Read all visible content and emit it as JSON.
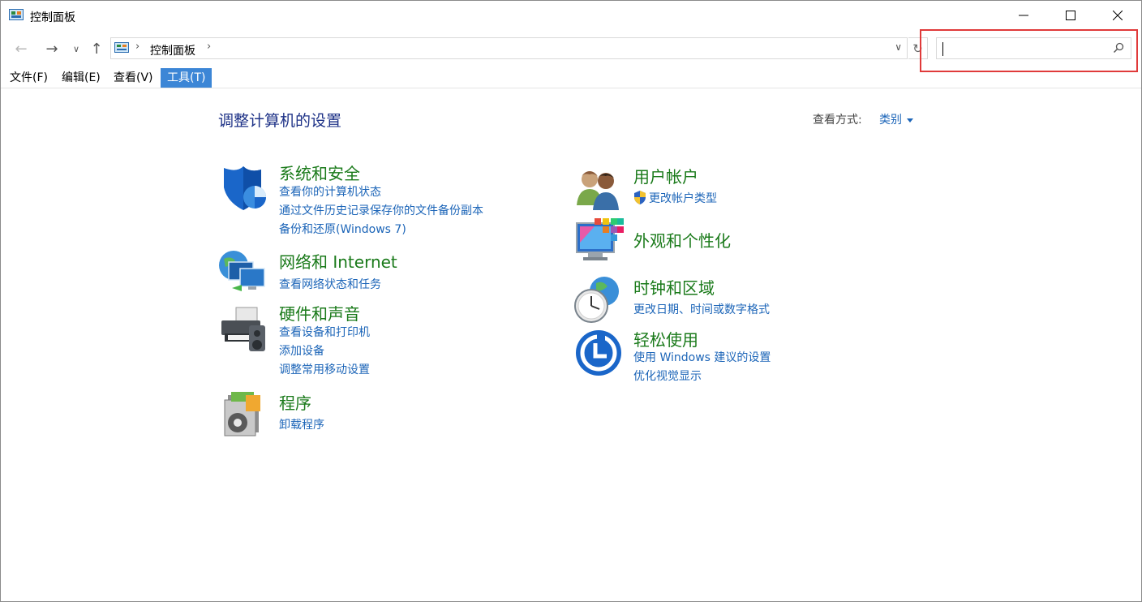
{
  "window": {
    "title": "控制面板"
  },
  "address_bar": {
    "path": [
      "控制面板"
    ],
    "search_placeholder": ""
  },
  "menu": {
    "items": [
      {
        "label": "文件(F)"
      },
      {
        "label": "编辑(E)"
      },
      {
        "label": "查看(V)"
      },
      {
        "label": "工具(T)",
        "active": true
      }
    ]
  },
  "content": {
    "title": "调整计算机的设置",
    "view_by_label": "查看方式:",
    "view_by_value": "类别",
    "categories": [
      {
        "title": "系统和安全",
        "icon": "security-shield-icon",
        "links": [
          "查看你的计算机状态",
          "通过文件历史记录保存你的文件备份副本",
          "备份和还原(Windows 7)"
        ]
      },
      {
        "title": "网络和 Internet",
        "icon": "network-globe-icon",
        "links": [
          "查看网络状态和任务"
        ]
      },
      {
        "title": "硬件和声音",
        "icon": "printer-speaker-icon",
        "links": [
          "查看设备和打印机",
          "添加设备",
          "调整常用移动设置"
        ]
      },
      {
        "title": "程序",
        "icon": "programs-disc-icon",
        "links": [
          "卸载程序"
        ]
      },
      {
        "title": "用户帐户",
        "icon": "user-accounts-icon",
        "links": [
          "更改帐户类型"
        ]
      },
      {
        "title": "外观和个性化",
        "icon": "appearance-monitor-icon",
        "links": []
      },
      {
        "title": "时钟和区域",
        "icon": "clock-globe-icon",
        "links": [
          "更改日期、时间或数字格式"
        ]
      },
      {
        "title": "轻松使用",
        "icon": "ease-of-access-icon",
        "links": [
          "使用 Windows 建议的设置",
          "优化视觉显示"
        ]
      }
    ]
  },
  "colors": {
    "category_title": "#1a7a1a",
    "link": "#1c65b8",
    "page_title": "#1e3287",
    "menu_active": "#3c86d6",
    "highlight": "#e03a3a"
  }
}
